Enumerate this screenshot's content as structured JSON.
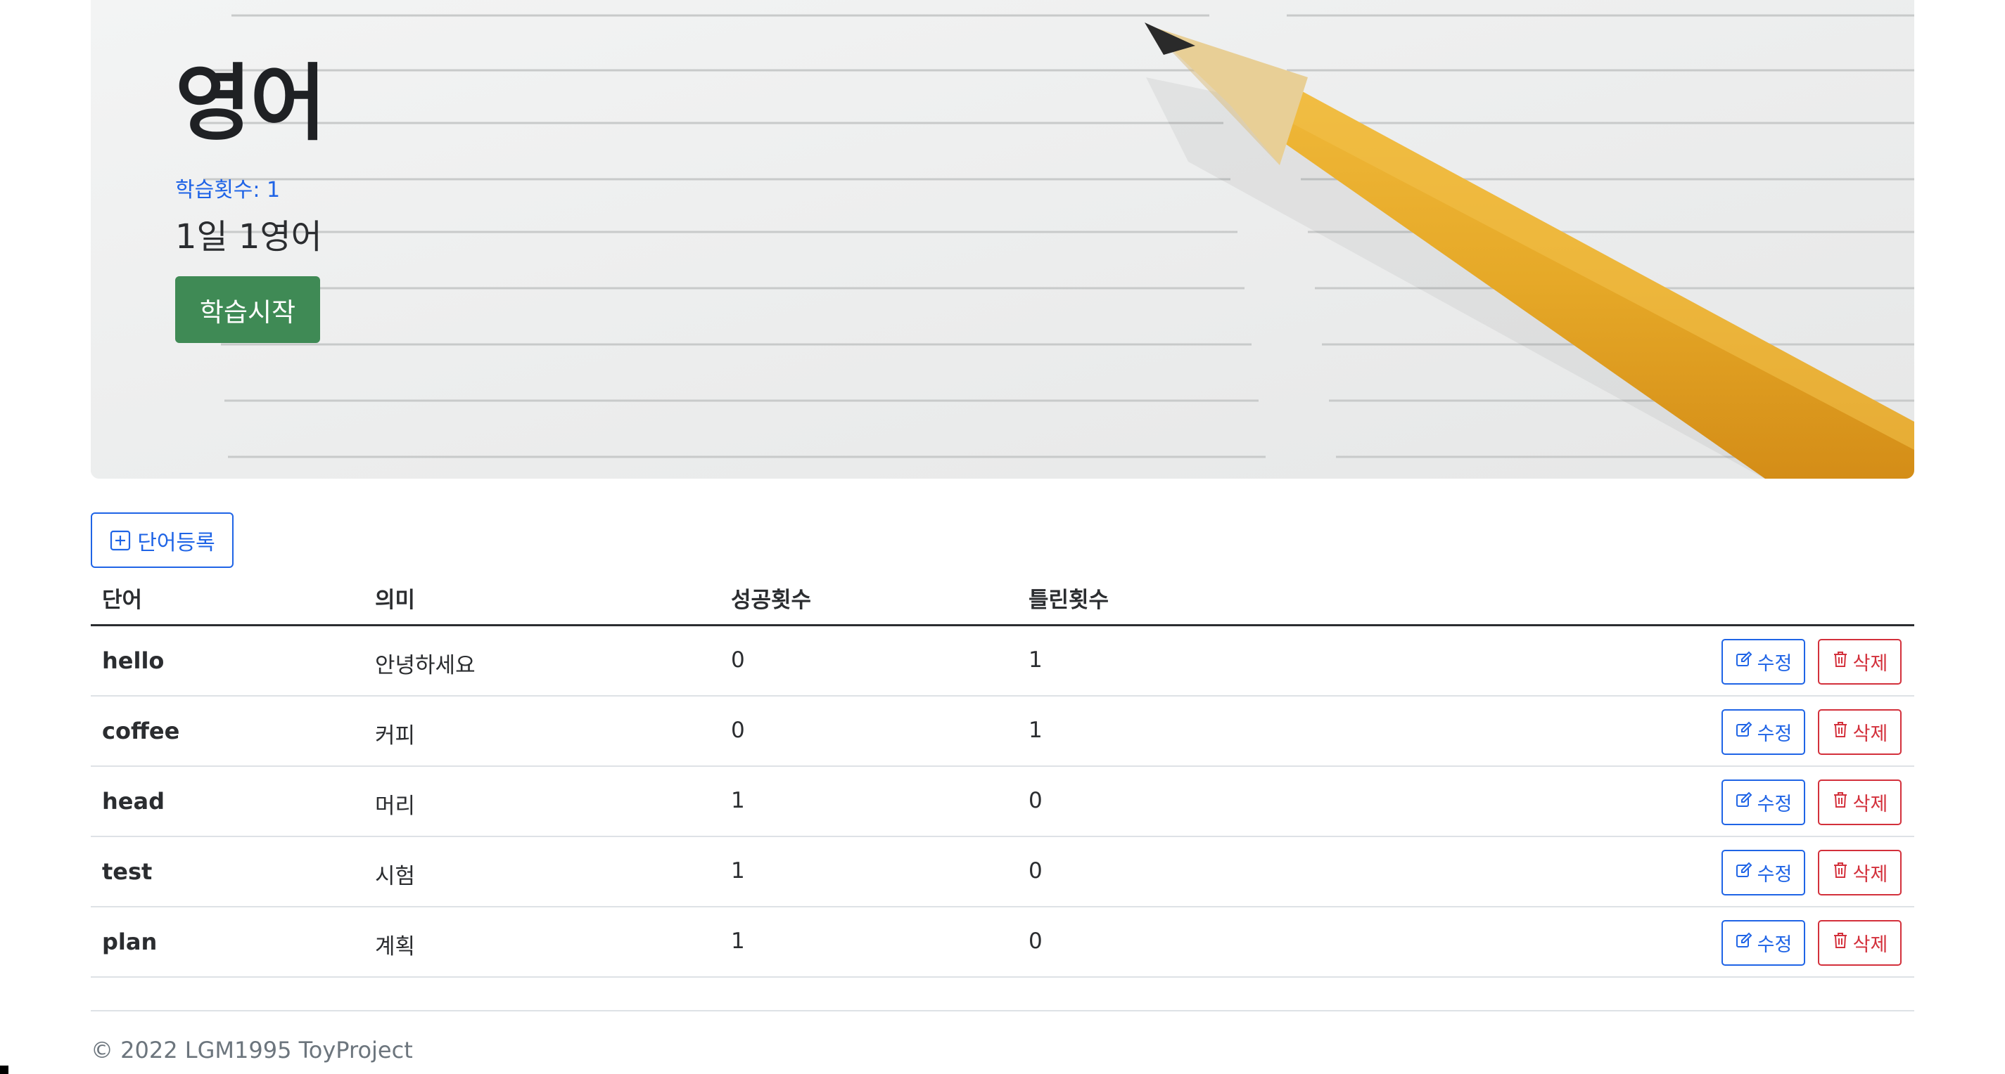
{
  "hero": {
    "title": "영어",
    "study_count": "학습횟수: 1",
    "description": "1일 1영어",
    "start_button": "학습시작"
  },
  "toolbar": {
    "add_word_label": "단어등록",
    "add_icon": "plus-square-icon"
  },
  "table": {
    "headers": [
      "단어",
      "의미",
      "성공횟수",
      "틀린횟수"
    ],
    "rows": [
      {
        "word": "hello",
        "meaning": "안녕하세요",
        "success": "0",
        "fail": "1"
      },
      {
        "word": "coffee",
        "meaning": "커피",
        "success": "0",
        "fail": "1"
      },
      {
        "word": "head",
        "meaning": "머리",
        "success": "1",
        "fail": "0"
      },
      {
        "word": "test",
        "meaning": "시험",
        "success": "1",
        "fail": "0"
      },
      {
        "word": "plan",
        "meaning": "계획",
        "success": "1",
        "fail": "0"
      }
    ],
    "edit_label": "수정",
    "delete_label": "삭제",
    "edit_icon": "pencil-square-icon",
    "delete_icon": "trash-icon"
  },
  "footer": {
    "copyright": "© 2022 LGM1995 ToyProject"
  },
  "colors": {
    "primary": "#1f64e6",
    "success": "#3f8a55",
    "danger": "#d3303b",
    "pencil": "#e8ae2e"
  }
}
